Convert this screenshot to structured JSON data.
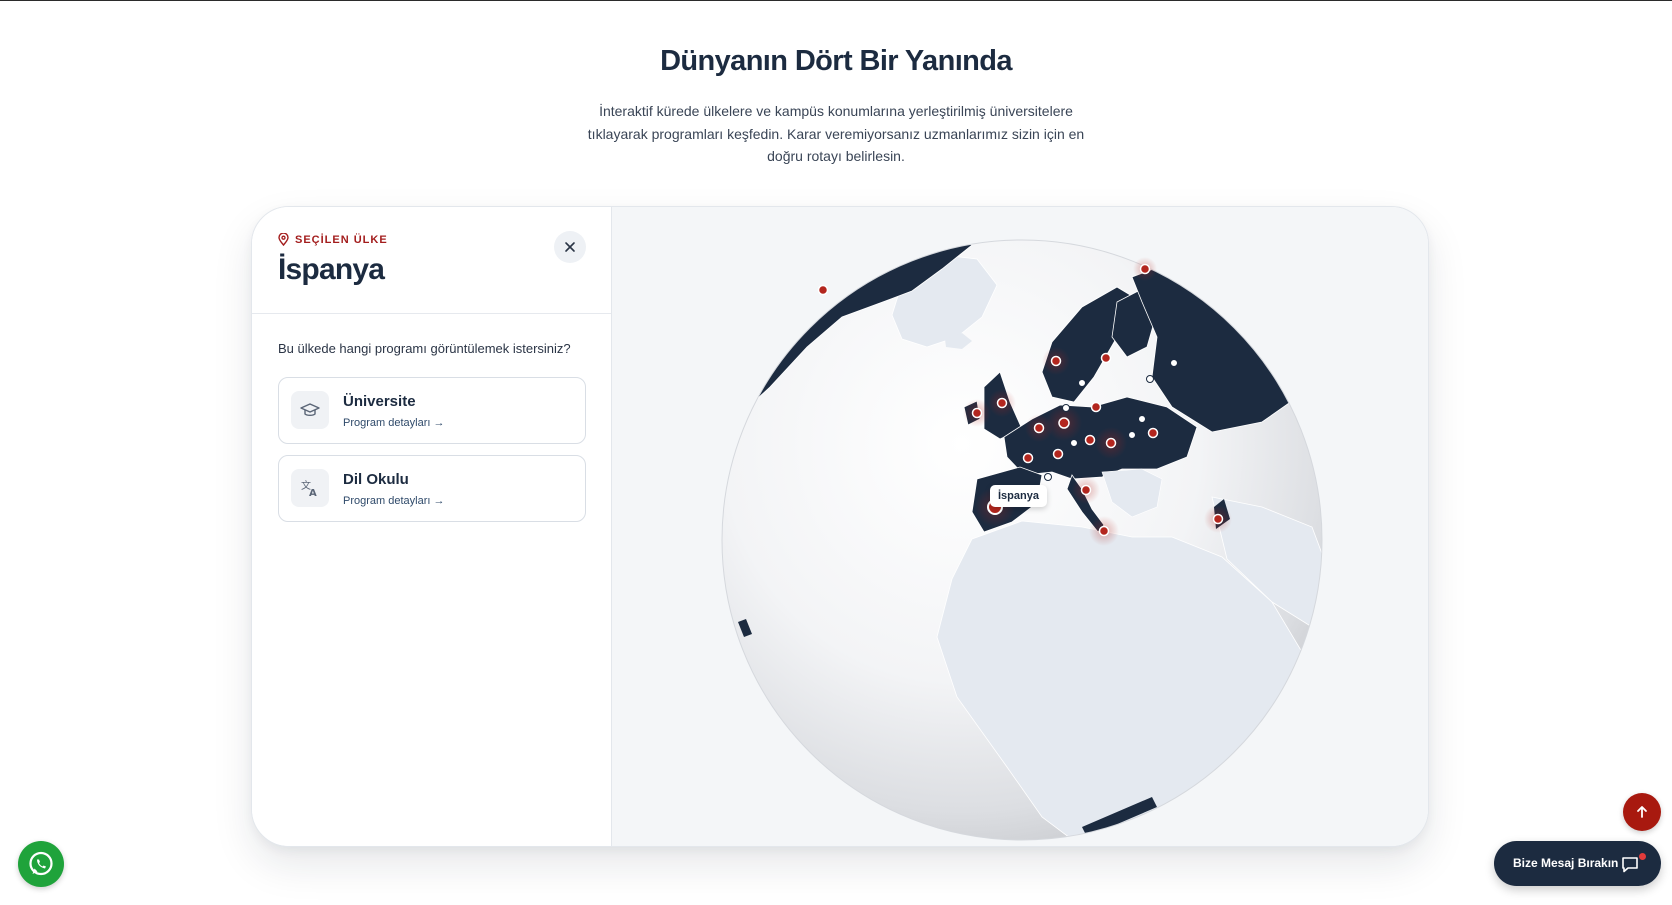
{
  "section": {
    "title": "Dünyanın Dört Bir Yanında",
    "description": "İnteraktif kürede ülkelere ve kampüs konumlarına yerleştirilmiş üniversitelere tıklayarak programları keşfedin. Karar veremiyorsanız uzmanlarımız sizin için en doğru rotayı belirlesin."
  },
  "panel": {
    "eyebrow": "SEÇİLEN ÜLKE",
    "country": "İspanya",
    "question": "Bu ülkede hangi programı görüntülemek istersiniz?",
    "options": [
      {
        "title": "Üniversite",
        "link": "Program detayları →",
        "icon": "graduation-cap-icon"
      },
      {
        "title": "Dil Okulu",
        "link": "Program detayları →",
        "icon": "translate-icon"
      }
    ]
  },
  "globe": {
    "tooltip": "İspanya",
    "land_color": "#1c2b40",
    "other_land_color": "#e4e9f0",
    "marker_color": "#b3261e"
  },
  "floating": {
    "message_label": "Bize Mesaj Bırakın",
    "whatsapp_color": "#1fa33b",
    "to_top_color": "#a8190f"
  }
}
